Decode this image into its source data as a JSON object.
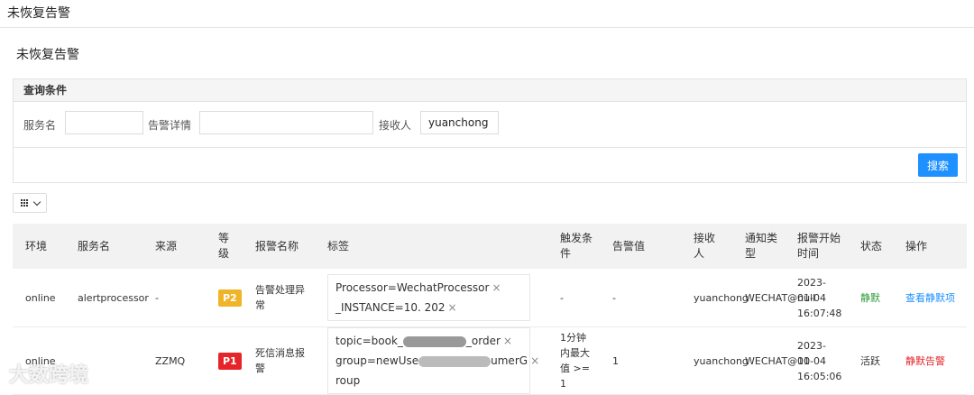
{
  "page": {
    "top_title": "未恢复告警",
    "section_title": "未恢复告警"
  },
  "query": {
    "title": "查询条件",
    "service_label": "服务名",
    "service_value": "",
    "detail_label": "告警详情",
    "detail_value": "",
    "receiver_label": "接收人",
    "receiver_value": "yuanchong",
    "search_label": "搜索"
  },
  "table": {
    "headers": [
      "环境",
      "服务名",
      "来源",
      "等级",
      "报警名称",
      "标签",
      "触发条件",
      "告警值",
      "接收人",
      "通知类型",
      "报警开始时间",
      "状态",
      "操作"
    ],
    "rows": [
      {
        "env": "online",
        "service": "alertprocessor",
        "source": "-",
        "level": "P2",
        "level_color": "#f0b429",
        "name": "告警处理异常",
        "tags": [
          "Processor=WechatProcessor",
          "_INSTANCE=10.          202"
        ],
        "condition": "-",
        "value": "-",
        "receiver": "yuanchong",
        "notify": "WECHAT@null",
        "start": "2023-01-04 16:07:48",
        "status": "静默",
        "status_color": "#2e9a3a",
        "action": "查看静默项",
        "action_color": "#1e90ff"
      },
      {
        "env": "online",
        "service": "",
        "source": "ZZMQ",
        "level": "P1",
        "level_color": "#e6252a",
        "name": "死信消息报警",
        "tags": [
          "topic=book_",
          "_order",
          "group=newUse",
          "umerG",
          "roup"
        ],
        "condition": "1分钟内最大值 >= 1",
        "value": "1",
        "receiver": "yuanchong",
        "notify": "WECHAT@10",
        "start": "2023-01-04 16:05:06",
        "status": "活跃",
        "status_color": "#333333",
        "action": "静默告警",
        "action_color": "#e6252a"
      }
    ]
  },
  "watermark": "大数跨境"
}
